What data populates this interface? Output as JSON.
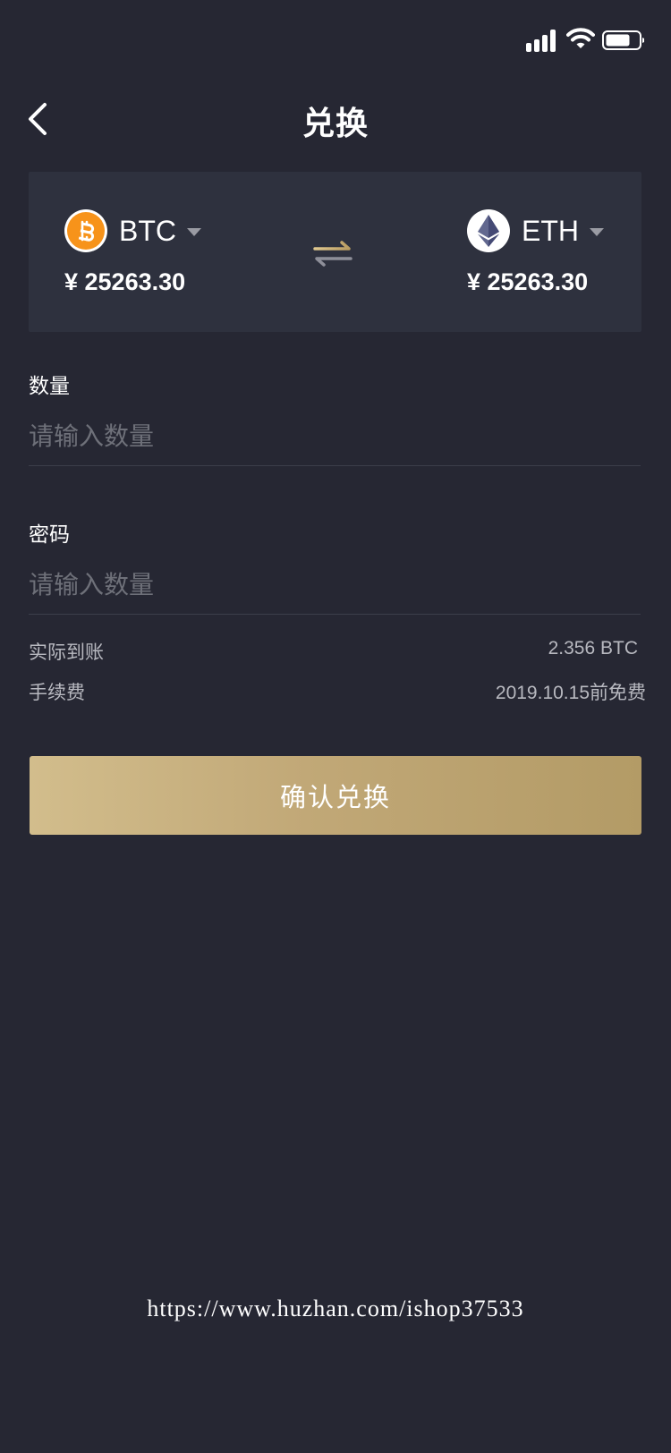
{
  "status_bar": {
    "icons": [
      "signal-icon",
      "wifi-icon",
      "battery-icon"
    ]
  },
  "header": {
    "title": "兑换",
    "back_icon": "chevron-left-icon"
  },
  "exchange": {
    "from": {
      "name": "BTC",
      "price": "¥ 25263.30",
      "icon": "bitcoin-icon",
      "color": "#f7931a"
    },
    "to": {
      "name": "ETH",
      "price": "¥ 25263.30",
      "icon": "ethereum-icon",
      "color": "#62688f"
    },
    "swap_icon": "swap-arrows-icon"
  },
  "form": {
    "quantity": {
      "label": "数量",
      "placeholder": "请输入数量",
      "value": ""
    },
    "password": {
      "label": "密码",
      "placeholder": "请输入数量",
      "value": ""
    }
  },
  "summary": {
    "received": {
      "label": "实际到账",
      "value": "2.356 BTC"
    },
    "fee": {
      "label": "手续费",
      "value": "2019.10.15前免费"
    }
  },
  "confirm_button": {
    "label": "确认兑换",
    "gradient": [
      "#d2bd8c",
      "#b39b66"
    ]
  },
  "watermark": "https://www.huzhan.com/ishop37533",
  "colors": {
    "background": "#262733",
    "card": "#2e313e",
    "accent": "#c1a877"
  }
}
